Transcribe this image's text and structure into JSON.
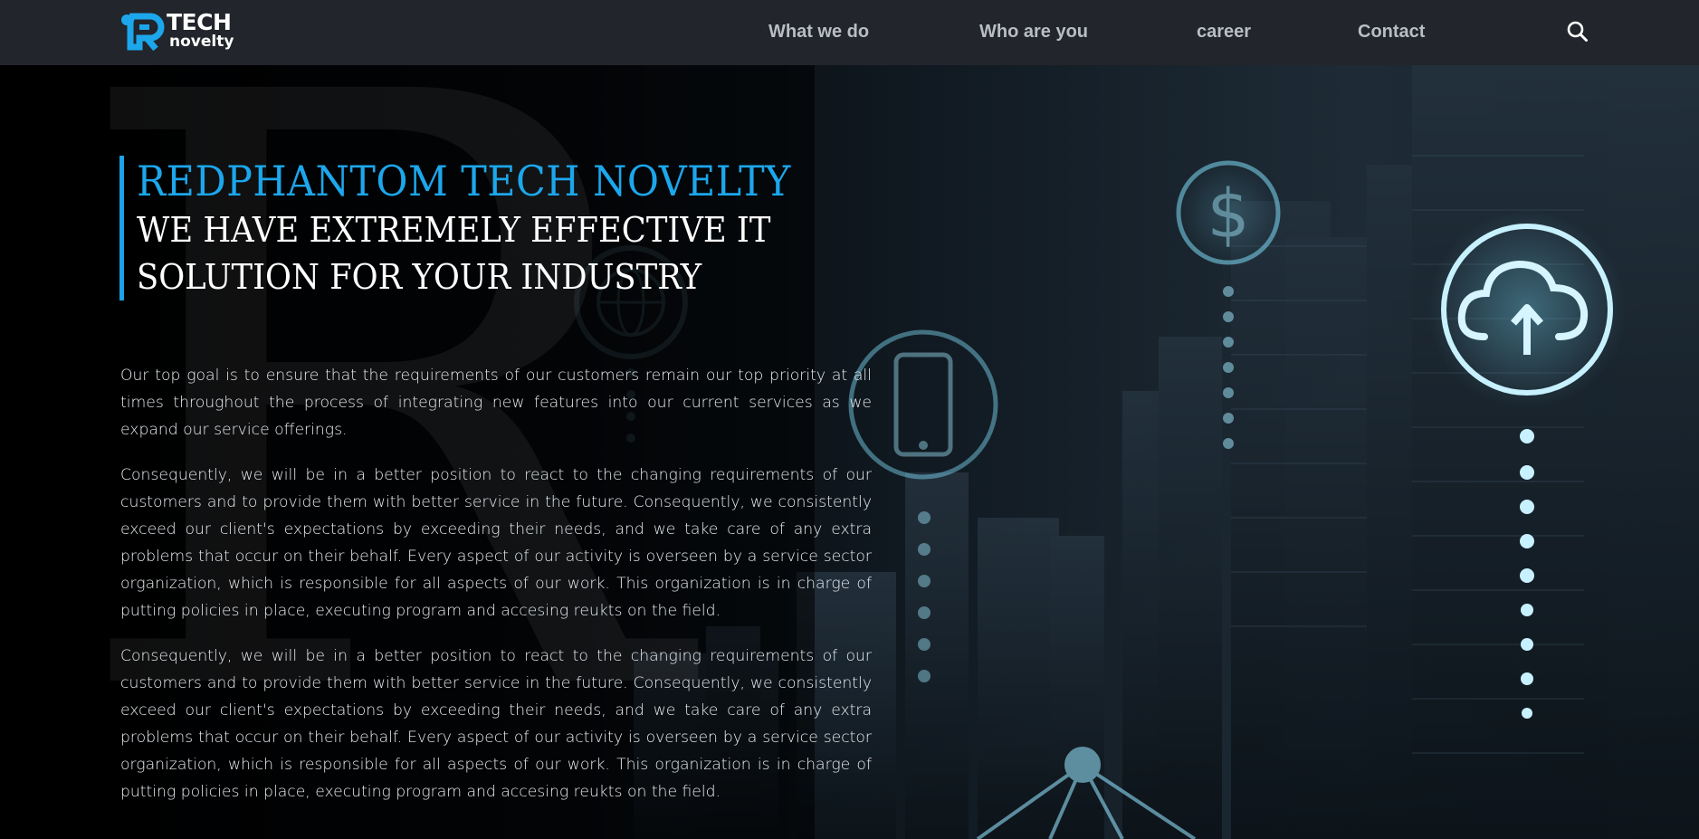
{
  "logo": {
    "brand": "TECH",
    "sub": "novelty"
  },
  "nav": {
    "items": [
      {
        "label": "What we do"
      },
      {
        "label": "Who are you"
      },
      {
        "label": "career"
      },
      {
        "label": "Contact"
      }
    ],
    "search_icon": "search-icon"
  },
  "hero": {
    "title": "REDPHANTOM TECH NOVELTY",
    "tagline": "WE HAVE EXTREMELY EFFECTIVE IT SOLUTION FOR YOUR INDUSTRY",
    "watermark": "R",
    "paragraphs": [
      "Our top goal is to ensure that the requirements of our customers remain our top priority at all times throughout the process of integrating new features into our current services as we expand our service offerings.",
      "Consequently, we will be in a better position to react to the changing requirements of our customers and to provide them with better service in the future. Consequently, we consistently exceed our client's expectations by exceeding their needs, and we take care of any extra problems that occur on their behalf. Every aspect of our activity is overseen by a service sector organization, which is responsible for all aspects of our work. This organization is in charge of putting policies in place, executing program and accesing reukts on the field.",
      "Consequently, we will be in a better position to react to the changing requirements of our customers and to provide them with better service in the future. Consequently, we consistently exceed our client's expectations by exceeding their needs, and we take care of any extra problems that occur on their behalf. Every aspect of our activity is overseen by a service sector organization, which is responsible for all aspects of our work. This organization is in charge of putting policies in place, executing program and accesing reukts on the field."
    ],
    "background_icons": [
      "dollar-icon",
      "globe-icon",
      "smartphone-icon",
      "cloud-upload-icon"
    ]
  },
  "colors": {
    "nav_bg": "#22252b",
    "accent": "#1ca7ec",
    "nav_text": "#b9bdc4",
    "body_text": "#e9eef2"
  }
}
